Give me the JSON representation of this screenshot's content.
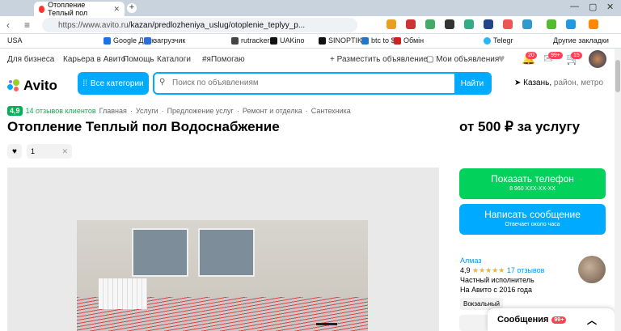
{
  "browser": {
    "tab_title": "Отопление Теплый пол",
    "url_host": "https://www.avito.ru",
    "url_path": "/kazan/predlozheniya_uslug/otoplenie_teplyy_p..."
  },
  "bookmarks": [
    "USA",
    "Google Диск",
    "загрузчик",
    "rutracker",
    "UAKino",
    "SINOPTIK",
    "btc to $",
    "Обмін",
    "Telegr",
    "Другие закладки"
  ],
  "topnav": {
    "business": "Для бизнеса",
    "career": "Карьера в Авито",
    "help": "Помощь",
    "catalogs": "Каталоги",
    "hashtag": "#яПомогаю",
    "post": "Разместить объявление",
    "my_ads": "Мои объявления",
    "badge_notif": "20",
    "badge_msgs": "99+",
    "badge_cart": "15"
  },
  "header": {
    "logo": "Avito",
    "categories": "Все категории",
    "search_placeholder": "Поиск по объявлениям",
    "search_button": "Найти",
    "city": "Казань,",
    "city_rest": "район, метро"
  },
  "crumbs": {
    "rating": "4,9",
    "reviews": "14 отзывов клиентов",
    "items": [
      "Главная",
      "Услуги",
      "Предложение услуг",
      "Ремонт и отделка",
      "Сантехника"
    ]
  },
  "listing": {
    "title": "Отопление Теплый пол Водоснабжение",
    "price": "от 500 ₽ за услугу",
    "qty": "1"
  },
  "contact": {
    "phone_btn": "Показать телефон",
    "phone_num": "8 960 XXX-XX-XX",
    "msg_btn": "Написать сообщение",
    "msg_sub": "Отвечает около часа"
  },
  "seller": {
    "name": "Алмаз",
    "rating": "4,9",
    "stars": "★★★★★",
    "reviews": "17 отзывов",
    "type": "Частный исполнитель",
    "since": "На Авито с 2016 года",
    "district": "Вокзальный"
  },
  "messages": {
    "label": "Сообщения",
    "count": "99+"
  }
}
